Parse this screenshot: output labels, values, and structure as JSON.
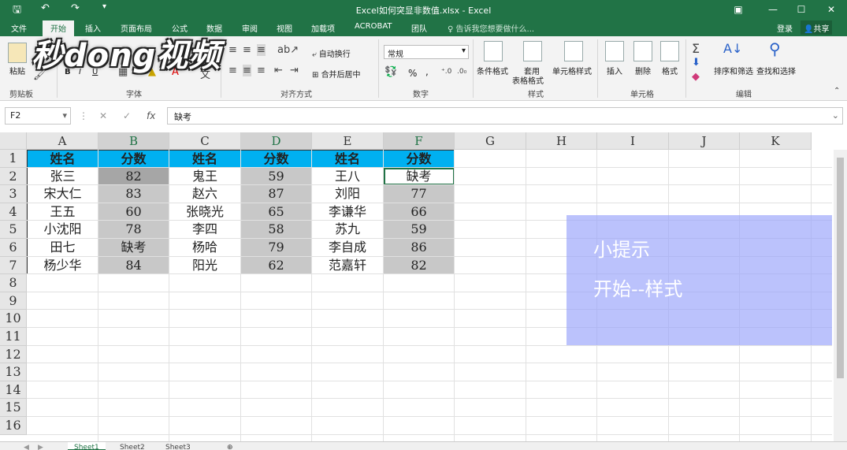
{
  "window": {
    "title": "Excel如何突显非数值.xlsx - Excel",
    "controls": [
      "▣",
      "—",
      "☐",
      "✕"
    ]
  },
  "quick_access": [
    "save-icon",
    "undo-icon",
    "redo-icon"
  ],
  "menu": {
    "tabs": [
      "文件",
      "开始",
      "插入",
      "页面布局",
      "公式",
      "数据",
      "审阅",
      "视图",
      "加载项",
      "ACROBAT",
      "团队"
    ],
    "active_tab": "开始",
    "tell_me": "告诉我您想要做什么...",
    "login": "登录",
    "share": "共享"
  },
  "ribbon": {
    "clipboard": {
      "paste": "粘贴",
      "label": "剪贴板"
    },
    "font": {
      "label": "字体",
      "bold": "B",
      "italic": "I",
      "underline": "U"
    },
    "alignment": {
      "wrap": "自动换行",
      "merge": "合并后居中",
      "label": "对齐方式"
    },
    "number": {
      "format": "常规",
      "percent": "%",
      "comma": ",",
      "label": "数字"
    },
    "styles": {
      "conditional": "条件格式",
      "table_line1": "套用",
      "table_line2": "表格格式",
      "cell_styles": "单元格样式",
      "label": "样式"
    },
    "cells": {
      "insert": "插入",
      "delete": "删除",
      "format": "格式",
      "label": "单元格"
    },
    "editing": {
      "sort": "排序和筛选",
      "find": "查找和选择",
      "label": "编辑"
    }
  },
  "logo_text": "秒dong视频",
  "formula_bar": {
    "name_box": "F2",
    "formula": "缺考",
    "fx": "fx"
  },
  "columns": [
    "A",
    "B",
    "C",
    "D",
    "E",
    "F",
    "G",
    "H",
    "I",
    "J",
    "K"
  ],
  "selected_columns": [
    "B",
    "D",
    "F"
  ],
  "rows": [
    "1",
    "2",
    "3",
    "4",
    "5",
    "6",
    "7",
    "8",
    "9",
    "10",
    "11",
    "12",
    "13",
    "14",
    "15",
    "16"
  ],
  "table": {
    "header": [
      "姓名",
      "分数",
      "姓名",
      "分数",
      "姓名",
      "分数"
    ],
    "body": [
      [
        "张三",
        "82",
        "鬼王",
        "59",
        "王八",
        "缺考"
      ],
      [
        "宋大仁",
        "83",
        "赵六",
        "87",
        "刘阳",
        "77"
      ],
      [
        "王五",
        "60",
        "张晓光",
        "65",
        "李谦华",
        "66"
      ],
      [
        "小沈阳",
        "78",
        "李四",
        "58",
        "苏九",
        "59"
      ],
      [
        "田七",
        "缺考",
        "杨哈",
        "79",
        "李自成",
        "86"
      ],
      [
        "杨少华",
        "84",
        "阳光",
        "62",
        "范嘉轩",
        "82"
      ]
    ]
  },
  "tip": {
    "line1": "小提示",
    "line2": "开始--样式"
  },
  "sheets": [
    "Sheet1",
    "Sheet2",
    "Sheet3"
  ],
  "active_sheet": "Sheet1",
  "colors": {
    "excel_green": "#217346",
    "header_fill": "#00b0f0",
    "score_fill": "#c8c8c8",
    "tip_fill": "#96a2fa"
  }
}
